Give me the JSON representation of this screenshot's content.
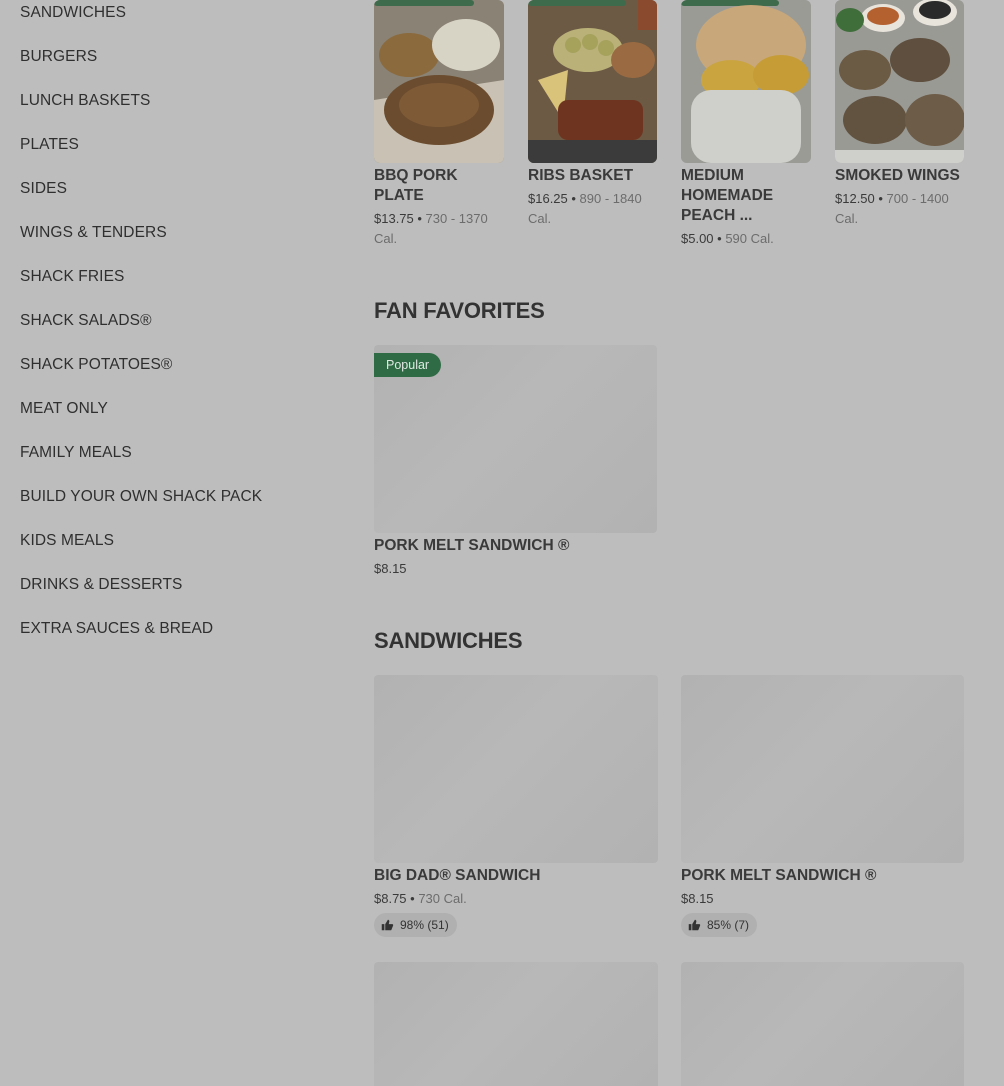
{
  "sidebar": {
    "items": [
      {
        "label": "SANDWICHES"
      },
      {
        "label": "BURGERS"
      },
      {
        "label": "LUNCH BASKETS"
      },
      {
        "label": "PLATES"
      },
      {
        "label": "SIDES"
      },
      {
        "label": "WINGS & TENDERS"
      },
      {
        "label": "SHACK FRIES"
      },
      {
        "label": "SHACK SALADS®"
      },
      {
        "label": "SHACK POTATOES®"
      },
      {
        "label": "MEAT ONLY"
      },
      {
        "label": "FAMILY MEALS"
      },
      {
        "label": "BUILD YOUR OWN SHACK PACK"
      },
      {
        "label": "KIDS MEALS"
      },
      {
        "label": "DRINKS & DESSERTS"
      },
      {
        "label": "EXTRA SAUCES & BREAD"
      }
    ]
  },
  "top_carousel": [
    {
      "title": "BBQ PORK PLATE",
      "price": "$13.75",
      "calories": "730 - 1370 Cal.",
      "image": "bbq-pork-plate-photo"
    },
    {
      "title": "RIBS BASKET",
      "price": "$16.25",
      "calories": "890 - 1840 Cal.",
      "image": "ribs-basket-photo"
    },
    {
      "title": "MEDIUM HOMEMADE PEACH ...",
      "price": "$5.00",
      "calories": "590 Cal.",
      "image": "peach-cobbler-photo"
    },
    {
      "title": "SMOKED WINGS",
      "price": "$12.50",
      "calories": "700 - 1400 Cal.",
      "image": "smoked-wings-photo"
    }
  ],
  "fan_favorites": {
    "title": "FAN FAVORITES",
    "items": [
      {
        "badge": "Popular",
        "title": "PORK MELT SANDWICH ®",
        "price": "$8.15"
      }
    ]
  },
  "sandwiches": {
    "title": "SANDWICHES",
    "items": [
      {
        "title": "BIG DAD® SANDWICH",
        "price": "$8.75",
        "calories": "730 Cal.",
        "rating": "98% (51)"
      },
      {
        "title": "PORK MELT SANDWICH ®",
        "price": "$8.15",
        "calories": "",
        "rating": "85% (7)"
      }
    ]
  },
  "colors": {
    "badge": "#2f6b45",
    "overlay": "#bdbdbd"
  }
}
